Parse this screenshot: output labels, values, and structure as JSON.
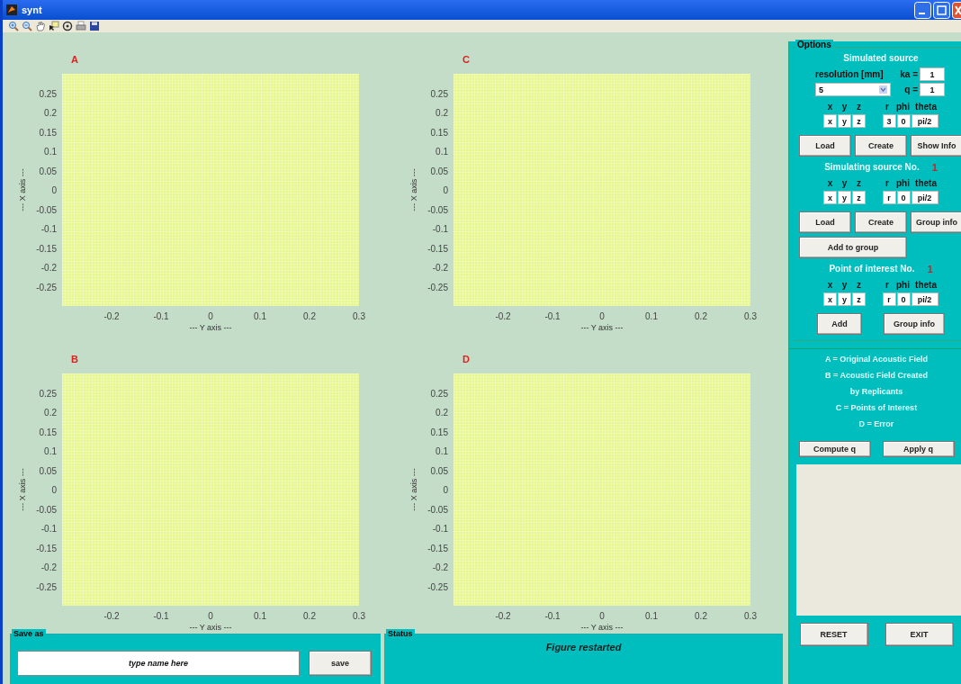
{
  "window": {
    "title": "synt"
  },
  "plots": [
    {
      "label": "A",
      "xlabel": "--- Y axis ---",
      "ylabel": "--- X axis ---",
      "xticks": [
        "-0.2",
        "-0.1",
        "0",
        "0.1",
        "0.2",
        "0.3"
      ],
      "yticks": [
        "0.25",
        "0.2",
        "0.15",
        "0.1",
        "0.05",
        "0",
        "-0.05",
        "-0.1",
        "-0.15",
        "-0.2",
        "-0.25"
      ]
    },
    {
      "label": "C",
      "xlabel": "--- Y axis ---",
      "ylabel": "--- X axis ---",
      "xticks": [
        "-0.2",
        "-0.1",
        "0",
        "0.1",
        "0.2",
        "0.3"
      ],
      "yticks": [
        "0.25",
        "0.2",
        "0.15",
        "0.1",
        "0.05",
        "0",
        "-0.05",
        "-0.1",
        "-0.15",
        "-0.2",
        "-0.25"
      ]
    },
    {
      "label": "B",
      "xlabel": "--- Y axis ---",
      "ylabel": "--- X axis ---",
      "xticks": [
        "-0.2",
        "-0.1",
        "0",
        "0.1",
        "0.2",
        "0.3"
      ],
      "yticks": [
        "0.25",
        "0.2",
        "0.15",
        "0.1",
        "0.05",
        "0",
        "-0.05",
        "-0.1",
        "-0.15",
        "-0.2",
        "-0.25"
      ]
    },
    {
      "label": "D",
      "xlabel": "--- Y axis ---",
      "ylabel": "--- X axis ---",
      "xticks": [
        "-0.2",
        "-0.1",
        "0",
        "0.1",
        "0.2",
        "0.3"
      ],
      "yticks": [
        "0.25",
        "0.2",
        "0.15",
        "0.1",
        "0.05",
        "0",
        "-0.05",
        "-0.1",
        "-0.15",
        "-0.2",
        "-0.25"
      ]
    }
  ],
  "save_as": {
    "title": "Save as",
    "field": {
      "placeholder": "type name here"
    },
    "button": "save"
  },
  "status": {
    "title": "Status",
    "message": "Figure restarted"
  },
  "options": {
    "title": "Options",
    "sections": [
      {
        "heading": "Simulated source",
        "resolution": {
          "label": "resolution [mm]",
          "value": "5",
          "ka_label": "ka =",
          "ka_value": "1",
          "q_label": "q =",
          "q_value": "1"
        },
        "cart_labels": [
          "x",
          "y",
          "z"
        ],
        "cart_values": [
          "x",
          "y",
          "z"
        ],
        "sph_labels": [
          "r",
          "phi",
          "theta"
        ],
        "sph_values": [
          "3",
          "0",
          "pi/2"
        ],
        "buttons": [
          "Load",
          "Create",
          "Show Info"
        ]
      },
      {
        "heading": "Simulating source No.",
        "number": "1",
        "cart_labels": [
          "x",
          "y",
          "z"
        ],
        "cart_values": [
          "x",
          "y",
          "z"
        ],
        "sph_labels": [
          "r",
          "phi",
          "theta"
        ],
        "sph_values": [
          "r",
          "0",
          "pi/2"
        ],
        "buttons": [
          "Load",
          "Create",
          "Group info",
          "Add to group"
        ]
      },
      {
        "heading": "Point of interest No.",
        "number": "1",
        "cart_labels": [
          "x",
          "y",
          "z"
        ],
        "cart_values": [
          "x",
          "y",
          "z"
        ],
        "sph_labels": [
          "r",
          "phi",
          "theta"
        ],
        "sph_values": [
          "r",
          "0",
          "pi/2"
        ],
        "buttons": [
          "Add",
          "Group info"
        ]
      }
    ],
    "legend": [
      "A = Original Acoustic Field",
      "B = Acoustic Field Created",
      "by Replicants",
      "C = Points of Interest",
      "D = Error"
    ],
    "q_buttons": [
      "Compute q",
      "Apply q"
    ],
    "bottom_buttons": [
      "RESET",
      "EXIT"
    ]
  }
}
